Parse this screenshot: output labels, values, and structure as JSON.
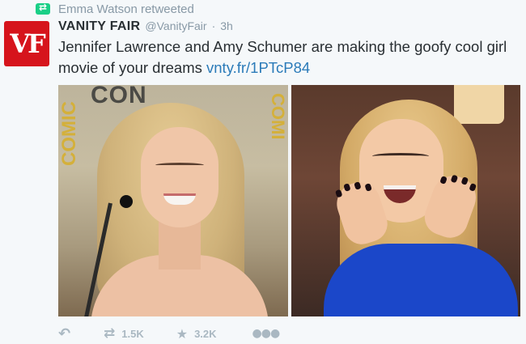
{
  "context": {
    "retweeter_text": "Emma Watson retweeted"
  },
  "author": {
    "avatar_text": "VF",
    "fullname": "VANITY FAIR",
    "screen_name": "@VanityFair",
    "separator": "·",
    "time": "3h"
  },
  "tweet": {
    "text": "Jennifer Lawrence and Amy Schumer are making the goofy cool girl movie of your dreams ",
    "link": "vnty.fr/1PTcP84"
  },
  "media": {
    "left_sign_top": "CON",
    "left_sign_side_left": "COMIC",
    "left_sign_side_right": "COMI"
  },
  "actions": {
    "retweet_count": "1.5K",
    "favorite_count": "3.2K"
  },
  "colors": {
    "link": "#2b7bb9",
    "retweet_green": "#19cf86",
    "brand_red": "#d6141c",
    "muted": "#8899a6"
  },
  "icons": {
    "reply": "reply-icon",
    "retweet": "retweet-icon",
    "favorite": "star-icon",
    "more": "more-icon"
  }
}
